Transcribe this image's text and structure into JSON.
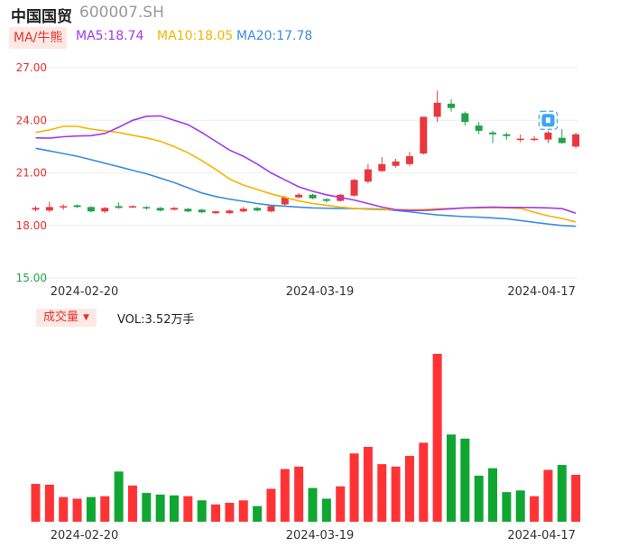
{
  "header": {
    "stock_name": "中国国贸",
    "stock_code": "600007.SH",
    "ma_badge": "MA/牛熊",
    "ma5_label": "MA5:18.74",
    "ma10_label": "MA10:18.05",
    "ma20_label": "MA20:17.78"
  },
  "volume_header": {
    "badge_label": "成交量",
    "caret": "▼",
    "vol_label": "VOL:3.52万手"
  },
  "colors": {
    "up": "#e8383d",
    "down": "#1fa34a",
    "ma5": "#a239ea",
    "ma10": "#f4b400",
    "ma20": "#3c8dde",
    "y_tick_label": "#e5322d",
    "y_tick_label_low": "#1fa34a",
    "grid": "#eeeeee",
    "volume_up": "#ff3336",
    "volume_down": "#10a632",
    "marker": "#3aa7f0"
  },
  "chart_data": [
    {
      "type": "candlestick",
      "y_ticks": [
        "27.00",
        "24.00",
        "21.00",
        "18.00",
        "15.00"
      ],
      "ylim": [
        15,
        27
      ],
      "x_ticks": [
        {
          "index": 3,
          "label": "2024-02-20"
        },
        {
          "index": 20,
          "label": "2024-03-19"
        },
        {
          "index": 36,
          "label": "2024-04-17"
        }
      ],
      "candles": [
        {
          "o": 18.9,
          "c": 19.0,
          "h": 19.1,
          "l": 18.8
        },
        {
          "o": 18.85,
          "c": 19.05,
          "h": 19.35,
          "l": 18.75
        },
        {
          "o": 19.05,
          "c": 19.1,
          "h": 19.2,
          "l": 18.9
        },
        {
          "o": 19.15,
          "c": 19.05,
          "h": 19.2,
          "l": 19.0
        },
        {
          "o": 19.05,
          "c": 18.8,
          "h": 19.1,
          "l": 18.75
        },
        {
          "o": 18.8,
          "c": 19.0,
          "h": 19.05,
          "l": 18.7
        },
        {
          "o": 19.1,
          "c": 19.0,
          "h": 19.3,
          "l": 18.95
        },
        {
          "o": 19.05,
          "c": 19.1,
          "h": 19.15,
          "l": 19.0
        },
        {
          "o": 19.05,
          "c": 19.0,
          "h": 19.1,
          "l": 18.9
        },
        {
          "o": 19.0,
          "c": 18.85,
          "h": 19.05,
          "l": 18.8
        },
        {
          "o": 18.9,
          "c": 19.0,
          "h": 19.05,
          "l": 18.85
        },
        {
          "o": 18.95,
          "c": 18.8,
          "h": 19.0,
          "l": 18.75
        },
        {
          "o": 18.9,
          "c": 18.75,
          "h": 18.95,
          "l": 18.7
        },
        {
          "o": 18.7,
          "c": 18.8,
          "h": 18.85,
          "l": 18.65
        },
        {
          "o": 18.7,
          "c": 18.85,
          "h": 18.9,
          "l": 18.65
        },
        {
          "o": 18.8,
          "c": 18.95,
          "h": 19.05,
          "l": 18.75
        },
        {
          "o": 19.0,
          "c": 18.85,
          "h": 19.05,
          "l": 18.8
        },
        {
          "o": 18.8,
          "c": 19.1,
          "h": 19.15,
          "l": 18.75
        },
        {
          "o": 19.2,
          "c": 19.6,
          "h": 19.7,
          "l": 19.1
        },
        {
          "o": 19.6,
          "c": 19.75,
          "h": 19.85,
          "l": 19.55
        },
        {
          "o": 19.75,
          "c": 19.55,
          "h": 19.8,
          "l": 19.5
        },
        {
          "o": 19.5,
          "c": 19.4,
          "h": 19.55,
          "l": 19.3
        },
        {
          "o": 19.4,
          "c": 19.75,
          "h": 19.8,
          "l": 19.35
        },
        {
          "o": 19.7,
          "c": 20.6,
          "h": 20.65,
          "l": 19.65
        },
        {
          "o": 20.5,
          "c": 21.2,
          "h": 21.5,
          "l": 20.4
        },
        {
          "o": 21.1,
          "c": 21.5,
          "h": 21.9,
          "l": 21.05
        },
        {
          "o": 21.4,
          "c": 21.65,
          "h": 21.8,
          "l": 21.3
        },
        {
          "o": 21.5,
          "c": 21.95,
          "h": 22.2,
          "l": 21.4
        },
        {
          "o": 22.1,
          "c": 24.2,
          "h": 24.2,
          "l": 22.05
        },
        {
          "o": 24.2,
          "c": 25.0,
          "h": 25.7,
          "l": 23.9
        },
        {
          "o": 24.95,
          "c": 24.7,
          "h": 25.2,
          "l": 24.5
        },
        {
          "o": 24.4,
          "c": 23.9,
          "h": 24.5,
          "l": 23.7
        },
        {
          "o": 23.7,
          "c": 23.4,
          "h": 23.9,
          "l": 23.2
        },
        {
          "o": 23.3,
          "c": 23.2,
          "h": 23.4,
          "l": 22.7
        },
        {
          "o": 23.2,
          "c": 23.1,
          "h": 23.3,
          "l": 22.9
        },
        {
          "o": 22.9,
          "c": 22.95,
          "h": 23.2,
          "l": 22.75
        },
        {
          "o": 22.9,
          "c": 22.95,
          "h": 23.1,
          "l": 22.8
        },
        {
          "o": 22.9,
          "c": 23.3,
          "h": 23.4,
          "l": 22.7
        },
        {
          "o": 23.0,
          "c": 22.7,
          "h": 23.5,
          "l": 22.65
        },
        {
          "o": 22.5,
          "c": 23.2,
          "h": 23.3,
          "l": 22.4
        }
      ],
      "ma5": [
        23.0,
        22.98,
        23.06,
        23.1,
        23.12,
        23.25,
        23.6,
        24.0,
        24.23,
        24.25,
        24.0,
        23.75,
        23.3,
        22.8,
        22.3,
        21.95,
        21.5,
        21.0,
        20.6,
        20.2,
        19.95,
        19.75,
        19.6,
        19.45,
        19.25,
        19.05,
        18.9,
        18.85,
        18.85,
        18.9,
        18.95,
        19.0,
        19.03,
        19.05,
        19.03,
        19.03,
        19.02,
        19.0,
        18.96,
        18.7
      ],
      "ma10": [
        23.3,
        23.45,
        23.65,
        23.65,
        23.5,
        23.4,
        23.3,
        23.15,
        23.0,
        22.8,
        22.5,
        22.15,
        21.7,
        21.2,
        20.65,
        20.3,
        20.05,
        19.8,
        19.6,
        19.4,
        19.25,
        19.15,
        19.05,
        18.97,
        18.92,
        18.9,
        18.9,
        18.9,
        18.9,
        18.95,
        18.97,
        19.0,
        19.0,
        19.02,
        19.0,
        18.97,
        18.75,
        18.55,
        18.4,
        18.2
      ],
      "ma20": [
        22.4,
        22.25,
        22.1,
        21.95,
        21.75,
        21.55,
        21.35,
        21.15,
        20.95,
        20.7,
        20.45,
        20.15,
        19.85,
        19.65,
        19.5,
        19.38,
        19.25,
        19.15,
        19.1,
        19.05,
        19.0,
        18.98,
        18.97,
        18.96,
        18.95,
        18.93,
        18.85,
        18.78,
        18.68,
        18.6,
        18.55,
        18.5,
        18.47,
        18.43,
        18.38,
        18.28,
        18.18,
        18.08,
        18.0,
        17.95
      ]
    },
    {
      "type": "bar",
      "series_title": "成交量",
      "unit": "万手",
      "x_ticks": [
        {
          "index": 3,
          "label": "2024-02-20"
        },
        {
          "index": 20,
          "label": "2024-03-19"
        },
        {
          "index": 36,
          "label": "2024-04-17"
        }
      ],
      "values": [
        2.3,
        2.25,
        1.5,
        1.4,
        1.5,
        1.55,
        3.05,
        2.2,
        1.75,
        1.65,
        1.6,
        1.55,
        1.3,
        1.05,
        1.15,
        1.3,
        0.95,
        2.0,
        3.2,
        3.35,
        2.05,
        1.4,
        2.15,
        4.15,
        4.55,
        3.5,
        3.35,
        4.0,
        4.8,
        10.2,
        5.3,
        5.05,
        2.8,
        3.25,
        1.8,
        1.9,
        1.55,
        3.15,
        3.45,
        2.85
      ],
      "up": [
        true,
        true,
        true,
        true,
        false,
        true,
        false,
        true,
        false,
        false,
        false,
        true,
        false,
        true,
        true,
        true,
        false,
        true,
        true,
        true,
        false,
        false,
        true,
        true,
        true,
        true,
        true,
        true,
        true,
        true,
        false,
        false,
        false,
        false,
        false,
        false,
        true,
        true,
        false,
        true
      ]
    }
  ]
}
